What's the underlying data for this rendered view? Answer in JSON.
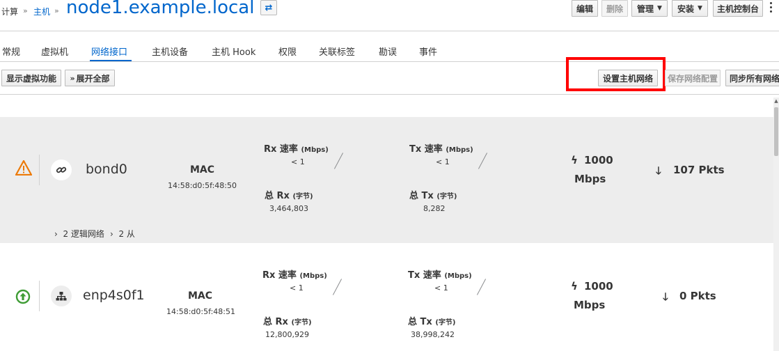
{
  "breadcrumb": {
    "compute": "计算",
    "hosts": "主机",
    "sep": "»"
  },
  "host_title": "node1.example.local",
  "toolbar": {
    "edit": "编辑",
    "delete": "删除",
    "manage": "管理",
    "install": "安装",
    "host_console": "主机控制台"
  },
  "tabs": [
    "常规",
    "虚拟机",
    "网络接口",
    "主机设备",
    "主机 Hook",
    "权限",
    "关联标签",
    "勘误",
    "事件"
  ],
  "subtoolbar": {
    "show_virtual": "显示虚拟功能",
    "expand_all": "展开全部",
    "setup_networks": "设置主机网络",
    "save_network_config": "保存网络配置",
    "sync_all_networks": "同步所有网络"
  },
  "labels": {
    "mac": "MAC",
    "rx_rate": "Rx 速率",
    "tx_rate": "Tx 速率",
    "rate_unit": "(Mbps)",
    "total_rx": "总 Rx",
    "total_tx": "总 Tx",
    "bytes_unit": "(字节)",
    "mbps": "Mbps"
  },
  "interfaces": [
    {
      "name": "bond0",
      "status": "warning",
      "type_icon": "bond-link-icon",
      "mac": "14:58:d0:5f:48:50",
      "rx_rate": "< 1",
      "tx_rate": "< 1",
      "total_rx": "3,464,803",
      "total_tx": "8,282",
      "speed": "1000",
      "pkts": "107 Pkts",
      "logical_networks": "2 逻辑网络",
      "slaves": "2 从"
    },
    {
      "name": "enp4s0f1",
      "status": "up",
      "type_icon": "nic-network-icon",
      "mac": "14:58:d0:5f:48:51",
      "rx_rate": "< 1",
      "tx_rate": "< 1",
      "total_rx": "12,800,929",
      "total_tx": "38,998,242",
      "speed": "1000",
      "pkts": "0 Pkts"
    }
  ],
  "colors": {
    "link": "#0066cc",
    "warning": "#ec7a08",
    "up": "#3f9c35",
    "highlight": "#ff0000"
  }
}
